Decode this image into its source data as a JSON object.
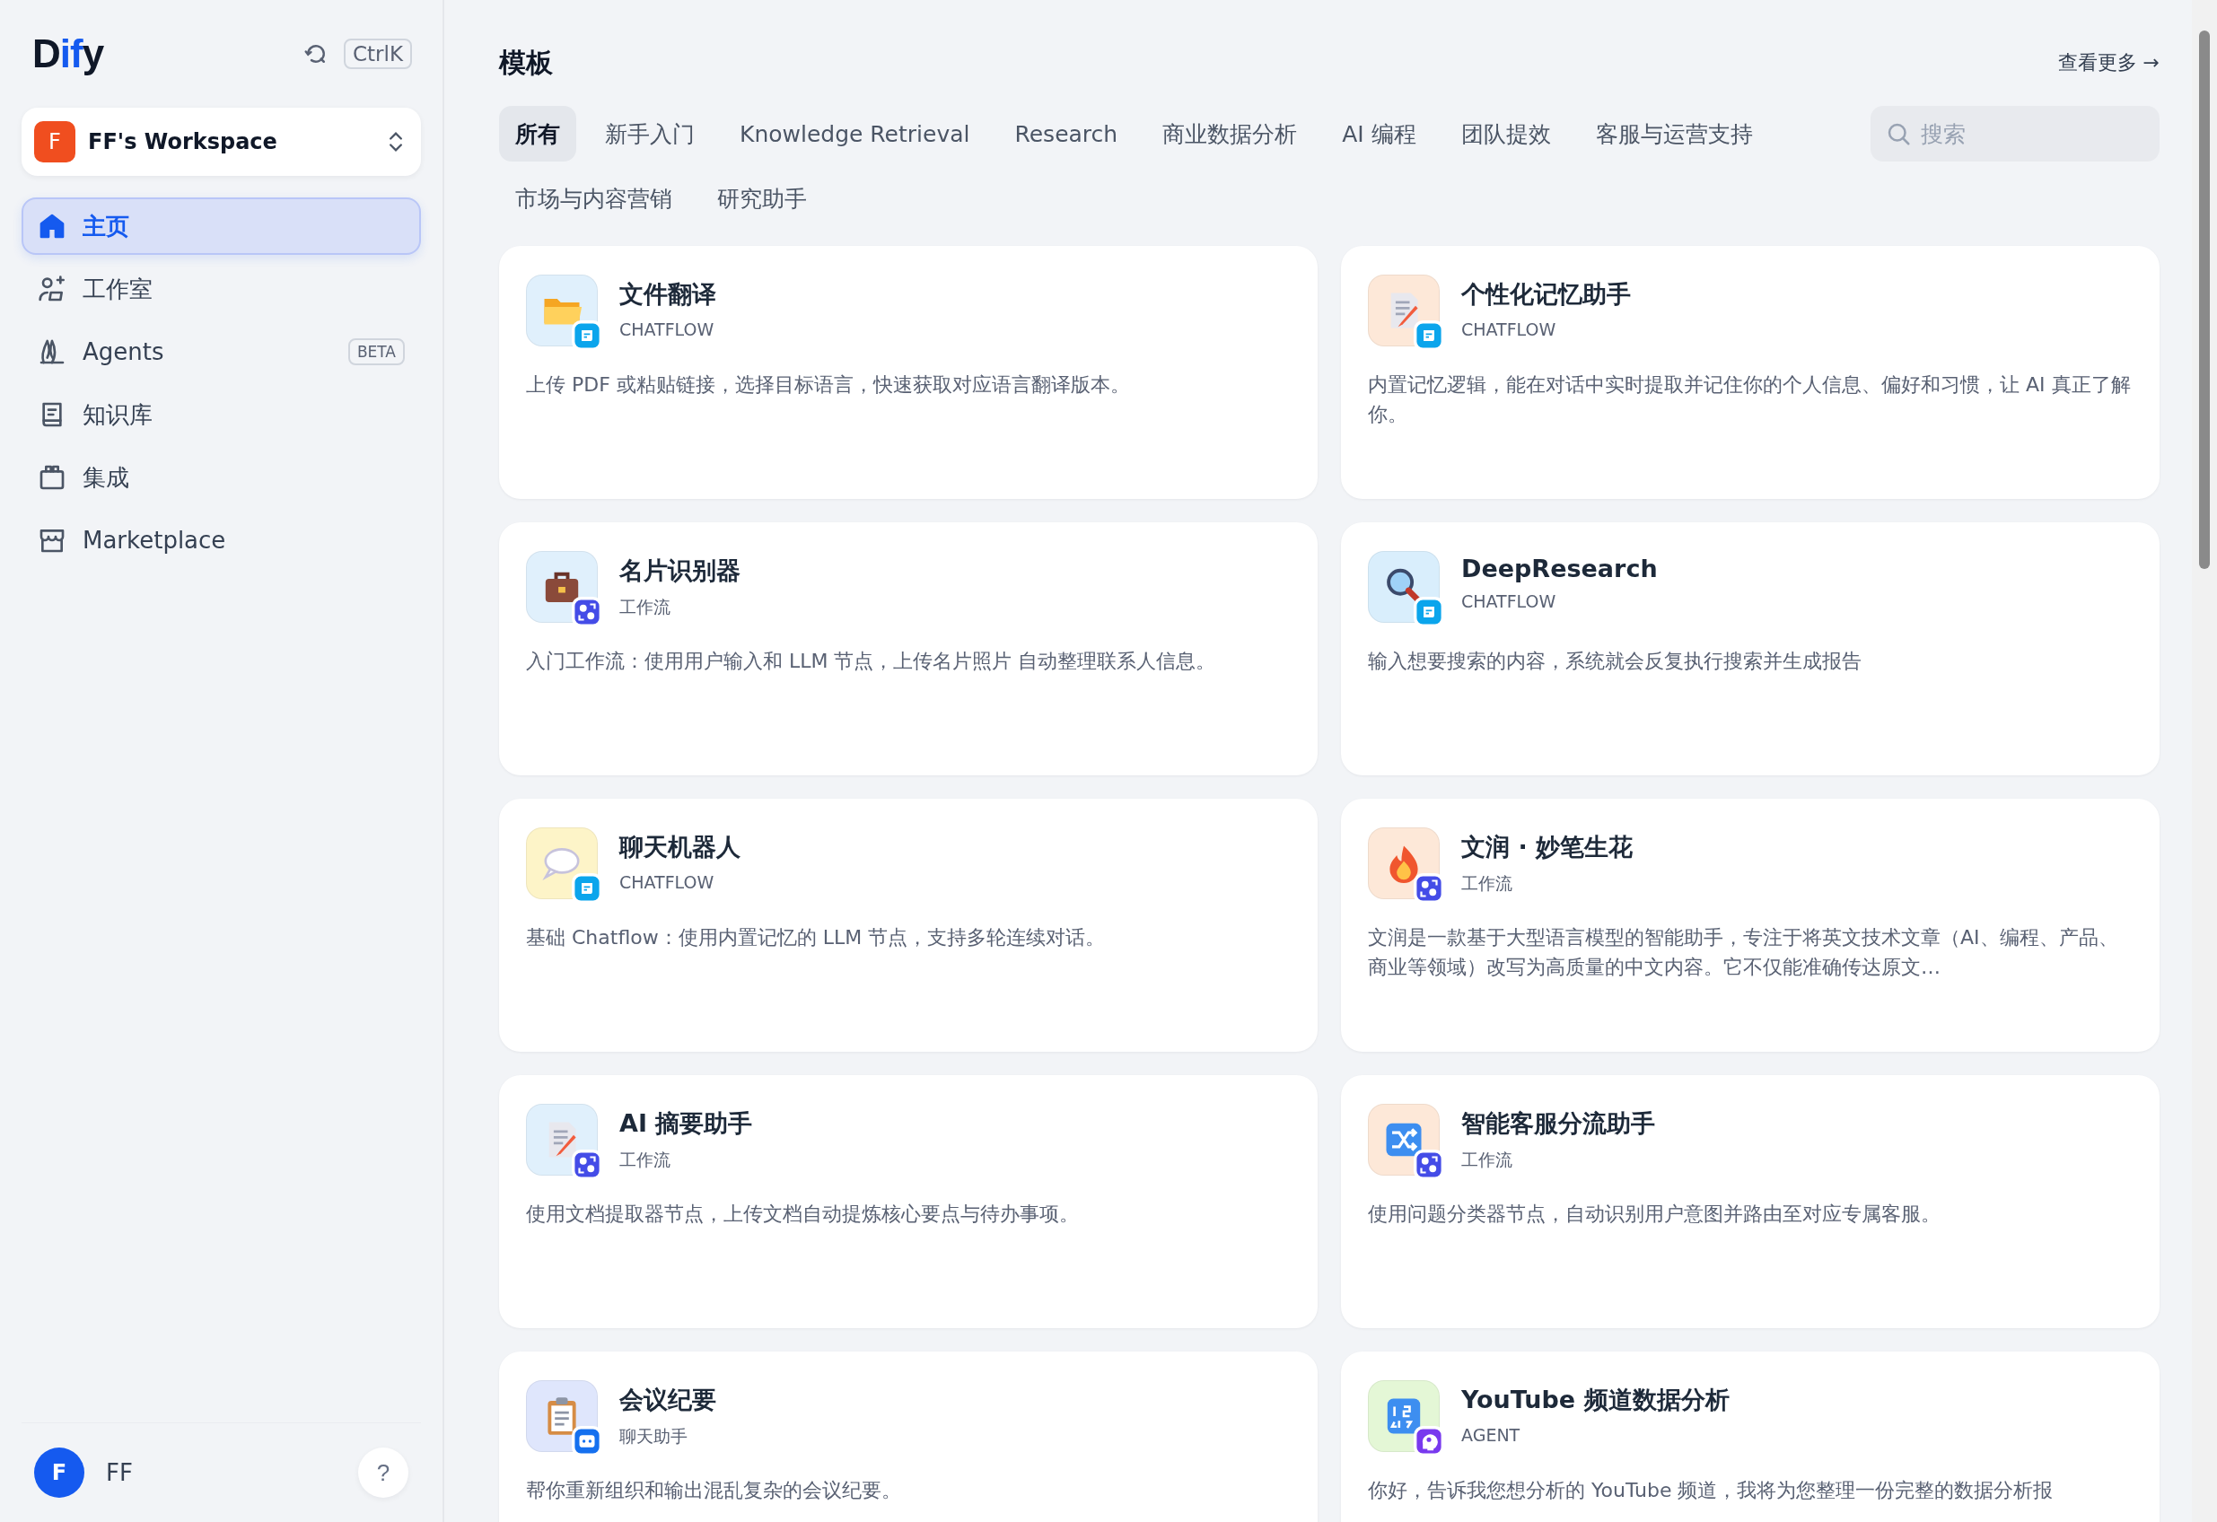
{
  "sidebar": {
    "logo": "Dify",
    "shortcut": "CtrlK",
    "workspace": {
      "avatar": "F",
      "name": "FF's Workspace"
    },
    "nav": [
      {
        "label": "主页",
        "selected": true
      },
      {
        "label": "工作室",
        "selected": false
      },
      {
        "label": "Agents",
        "selected": false,
        "badge": "BETA"
      },
      {
        "label": "知识库",
        "selected": false
      },
      {
        "label": "集成",
        "selected": false
      },
      {
        "label": "Marketplace",
        "selected": false
      }
    ],
    "user": {
      "avatar": "F",
      "name": "FF"
    },
    "help": "?"
  },
  "main": {
    "title": "模板",
    "more": "查看更多 →",
    "tabs": [
      {
        "label": "所有",
        "selected": true
      },
      {
        "label": "新手入门",
        "selected": false
      },
      {
        "label": "Knowledge Retrieval",
        "selected": false
      },
      {
        "label": "Research",
        "selected": false
      },
      {
        "label": "商业数据分析",
        "selected": false
      },
      {
        "label": "AI 编程",
        "selected": false
      },
      {
        "label": "团队提效",
        "selected": false
      },
      {
        "label": "客服与运营支持",
        "selected": false
      },
      {
        "label": "市场与内容营销",
        "selected": false
      },
      {
        "label": "研究助手",
        "selected": false
      }
    ],
    "search": {
      "placeholder": "搜索"
    },
    "cards": [
      {
        "title": "文件翻译",
        "type": "CHATFLOW",
        "kind": "chatflow",
        "color": "#e0f0fc",
        "description": "上传 PDF 或粘贴链接，选择目标语言，快速获取对应语言翻译版本。"
      },
      {
        "title": "个性化记忆助手",
        "type": "CHATFLOW",
        "kind": "chatflow",
        "color": "#fde8d8",
        "description": "内置记忆逻辑，能在对话中实时提取并记住你的个人信息、偏好和习惯，让 AI 真正了解你。"
      },
      {
        "title": "名片识别器",
        "type": "工作流",
        "kind": "workflow",
        "color": "#e0f0fc",
        "description": "入门工作流：使用用户输入和 LLM 节点，上传名片照片 自动整理联系人信息。"
      },
      {
        "title": "DeepResearch",
        "type": "CHATFLOW",
        "kind": "chatflow",
        "color": "#d9eefc",
        "description": "输入想要搜索的内容，系统就会反复执行搜索并生成报告"
      },
      {
        "title": "聊天机器人",
        "type": "CHATFLOW",
        "kind": "chatflow",
        "color": "#fdf4c8",
        "description": "基础 Chatflow：使用内置记忆的 LLM 节点，支持多轮连续对话。"
      },
      {
        "title": "文润 · 妙笔生花",
        "type": "工作流",
        "kind": "workflow",
        "color": "#fde8d8",
        "description": "文润是一款基于大型语言模型的智能助手，专注于将英文技术文章（AI、编程、产品、商业等领域）改写为高质量的中文内容。它不仅能准确传达原文…"
      },
      {
        "title": "AI 摘要助手",
        "type": "工作流",
        "kind": "workflow",
        "color": "#e0f0fc",
        "description": "使用文档提取器节点，上传文档自动提炼核心要点与待办事项。"
      },
      {
        "title": "智能客服分流助手",
        "type": "工作流",
        "kind": "workflow",
        "color": "#fde8d8",
        "description": "使用问题分类器节点，自动识别用户意图并路由至对应专属客服。"
      },
      {
        "title": "会议纪要",
        "type": "聊天助手",
        "kind": "chatbot",
        "color": "#dfe6fc",
        "description": "帮你重新组织和输出混乱复杂的会议纪要。"
      },
      {
        "title": "YouTube 频道数据分析",
        "type": "AGENT",
        "kind": "agent",
        "color": "#e4f7d6",
        "description": "你好，告诉我您想分析的 YouTube 频道，我将为您整理一份完整的数据分析报"
      }
    ]
  }
}
